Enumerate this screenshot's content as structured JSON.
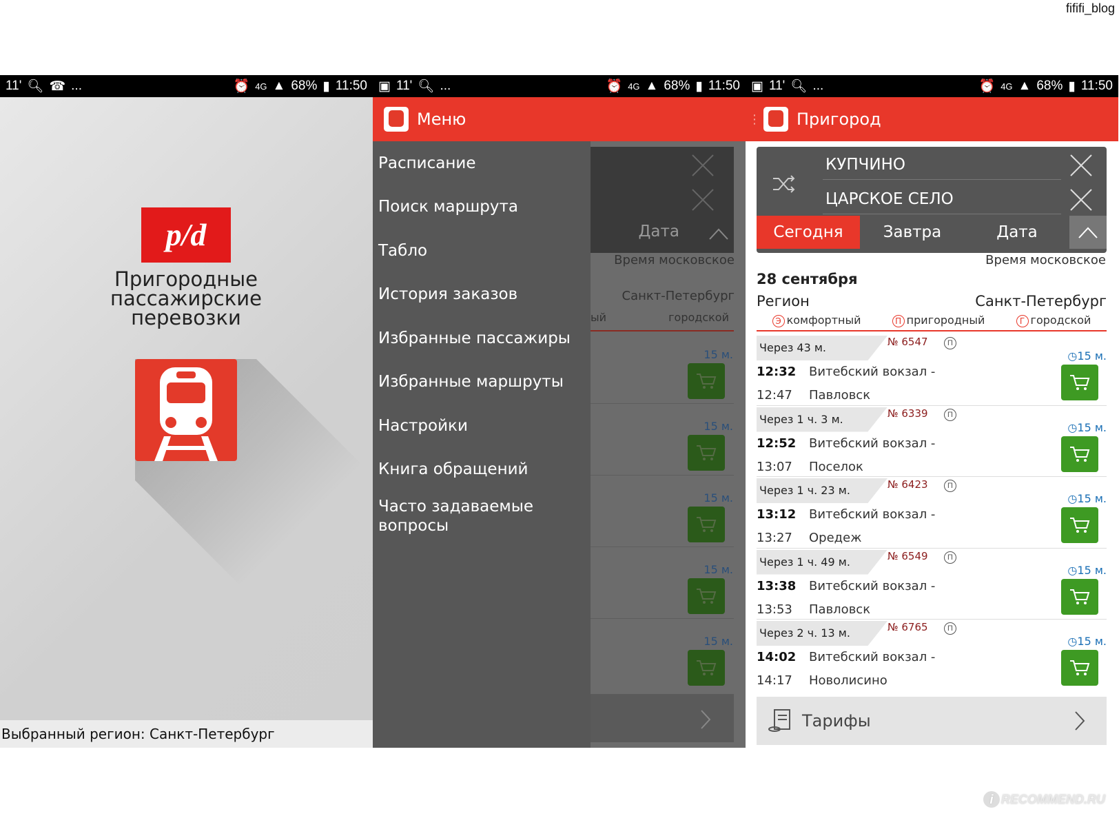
{
  "watermark_top": "fififi_blog",
  "watermark_bottom": "RECOMMEND.RU",
  "status_bars": [
    {
      "left": "11'",
      "dots": "...",
      "network": "4G",
      "battery": "68%",
      "time": "11:50"
    },
    {
      "left": "11'",
      "dots": "...",
      "network": "4G",
      "battery": "68%",
      "time": "11:50"
    },
    {
      "left": "11'",
      "dots": "...",
      "network": "4G",
      "battery": "68%",
      "time": "11:50"
    }
  ],
  "splash": {
    "logo_text": "p/d",
    "title_lines": [
      "Пригородные",
      "пассажирские",
      "перевозки"
    ],
    "region_label": "Выбранный регион: Санкт-Петербург"
  },
  "menu": {
    "title": "Меню",
    "items": [
      "Расписание",
      "Поиск маршрута",
      "Табло",
      "История заказов",
      "Избранные пассажиры",
      "Избранные маршруты",
      "Настройки",
      "Книга обращений",
      "Часто задаваемые вопросы"
    ],
    "dim_date": "Дата",
    "dim_time_note": "Время московское",
    "dim_city": "Санкт-Петербург",
    "dim_type_left": "ый",
    "dim_type": "городской",
    "dim_duration": "15 м."
  },
  "main": {
    "title": "Пригород",
    "from": "КУПЧИНО",
    "to": "ЦАРСКОЕ СЕЛО",
    "tabs": {
      "today": "Сегодня",
      "tomorrow": "Завтра",
      "date": "Дата"
    },
    "time_note": "Время московское",
    "date_heading": "28 сентября",
    "region_label": "Регион",
    "region_value": "Санкт-Петербург",
    "types": [
      {
        "badge": "Э",
        "label": "комфортный"
      },
      {
        "badge": "П",
        "label": "пригородный"
      },
      {
        "badge": "Г",
        "label": "городской"
      }
    ],
    "trains": [
      {
        "through": "Через 43 м.",
        "number": "№ 6547",
        "type": "П",
        "dep": "12:32",
        "arr": "12:47",
        "from": "Витебский вокзал -",
        "to": "Павловск",
        "duration": "15 м."
      },
      {
        "through": "Через 1 ч. 3 м.",
        "number": "№ 6339",
        "type": "П",
        "dep": "12:52",
        "arr": "13:07",
        "from": "Витебский вокзал -",
        "to": "Поселок",
        "duration": "15 м."
      },
      {
        "through": "Через 1 ч. 23 м.",
        "number": "№ 6423",
        "type": "П",
        "dep": "13:12",
        "arr": "13:27",
        "from": "Витебский вокзал -",
        "to": "Оредеж",
        "duration": "15 м."
      },
      {
        "through": "Через 1 ч. 49 м.",
        "number": "№ 6549",
        "type": "П",
        "dep": "13:38",
        "arr": "13:53",
        "from": "Витебский вокзал -",
        "to": "Павловск",
        "duration": "15 м."
      },
      {
        "through": "Через 2 ч. 13 м.",
        "number": "№ 6765",
        "type": "П",
        "dep": "14:02",
        "arr": "14:17",
        "from": "Витебский вокзал -",
        "to": "Новолисино",
        "duration": "15 м."
      }
    ],
    "tariffs": "Тарифы"
  },
  "colors": {
    "accent": "#e8372a",
    "cart": "#3e9a23",
    "duration": "#1a6fb5"
  }
}
